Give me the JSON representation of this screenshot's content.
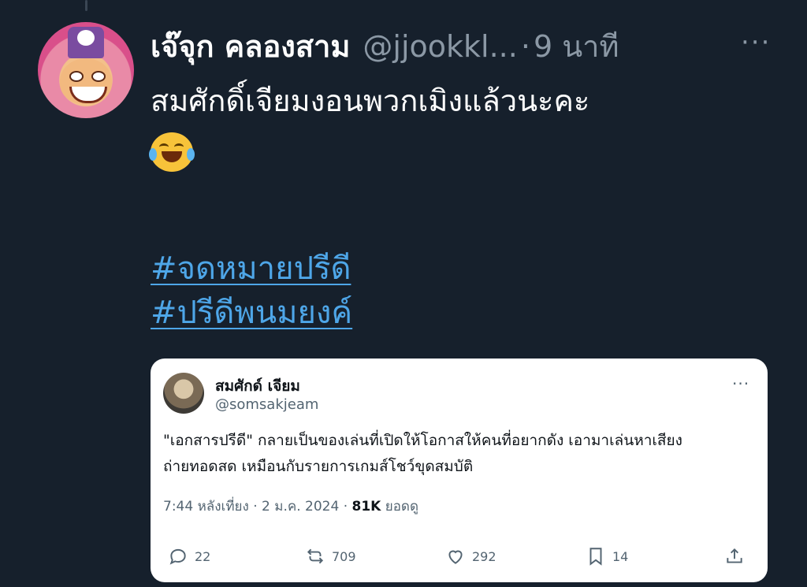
{
  "tweet": {
    "author_name": "เจ๊จุก คลองสาม",
    "author_handle": "@jjookkl...",
    "separator": "·",
    "time": "9 นาที",
    "more_label": "···",
    "text": "สมศักดิ์เจียมงอนพวกเมิงแล้วนะคะ",
    "emoji": "face-with-tears-of-joy",
    "hashtags": [
      "#จดหมายปรีดี",
      "#ปรีดีพนมยงค์"
    ]
  },
  "quoted": {
    "author_name": "สมศักด์ เจียม",
    "author_handle": "@somsakjeam",
    "more_label": "···",
    "text_line1": "\"เอกสารปรีดี\" กลายเป็นของเล่นที่เปิดให้โอกาสให้คนที่อยากดัง เอามาเล่นหาเสียง",
    "text_line2": "ถ่ายทอดสด เหมือนกับรายการเกมส์โชว์ขุดสมบัติ",
    "time": "7:44 หลังเที่ยง",
    "date": "2 ม.ค. 2024",
    "views_count": "81K",
    "views_label": "ยอดดู",
    "actions": {
      "replies": "22",
      "reposts": "709",
      "likes": "292",
      "bookmarks": "14"
    }
  }
}
